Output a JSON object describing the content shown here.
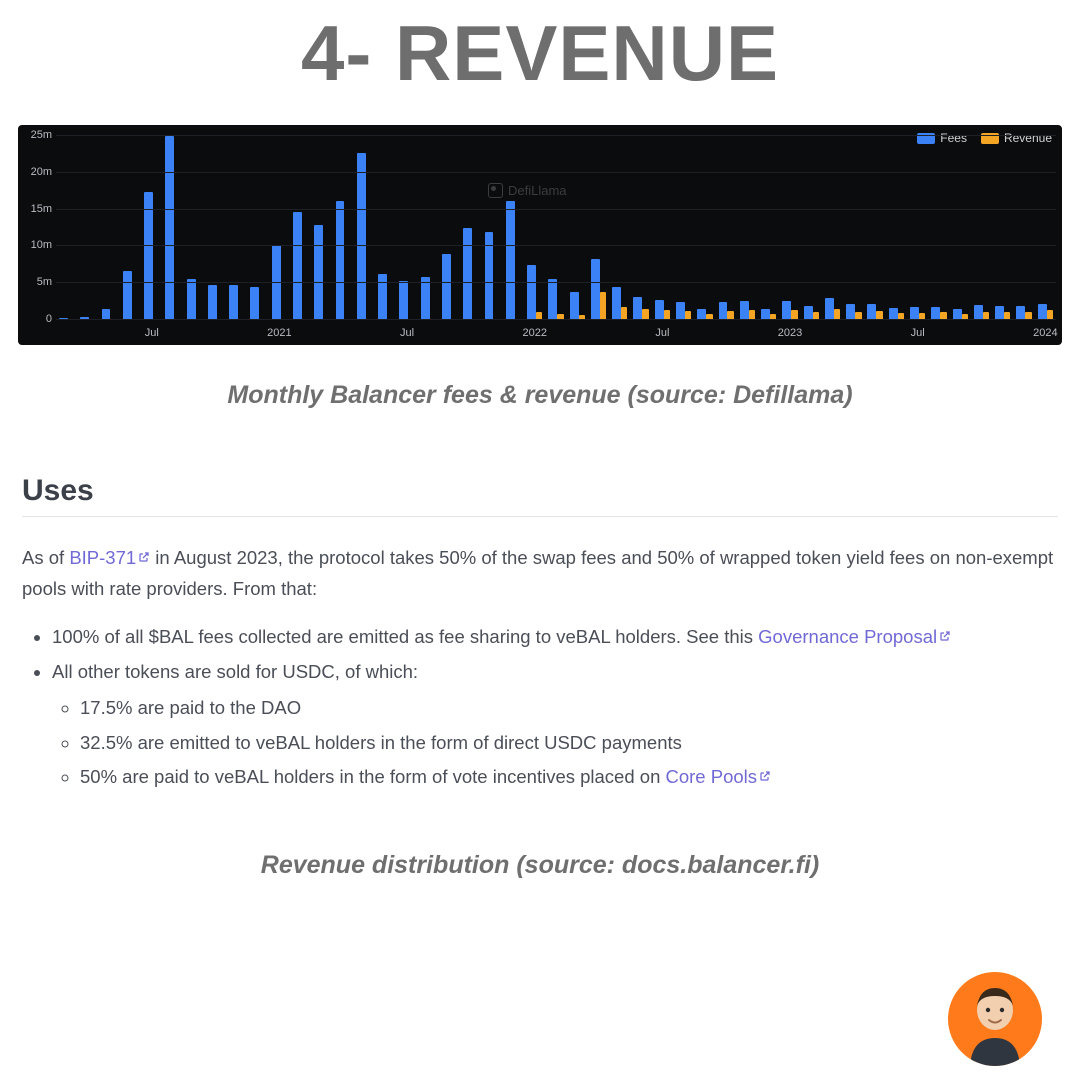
{
  "title": "4- REVENUE",
  "chart_caption": "Monthly Balancer fees & revenue (source: Defillama)",
  "uses": {
    "heading": "Uses",
    "intro_prefix": "As of ",
    "intro_link": "BIP-371",
    "intro_rest": " in August 2023, the protocol takes 50% of the swap fees and 50% of wrapped token yield fees on non-exempt pools with rate providers. From that:",
    "bullets": {
      "b1_prefix": "100% of all $BAL fees collected are emitted as fee sharing to veBAL holders. See this ",
      "b1_link": "Governance Proposal",
      "b2": "All other tokens are sold for USDC, of which:",
      "b2_sub1": "17.5% are paid to the DAO",
      "b2_sub2": "32.5% are emitted to veBAL holders in the form of direct USDC payments",
      "b2_sub3_prefix": "50% are paid to veBAL holders in the form of vote incentives placed on ",
      "b2_sub3_link": "Core Pools"
    }
  },
  "caption2": "Revenue distribution (source: docs.balancer.fi)",
  "chart": {
    "watermark": "DefiLlama",
    "legend": {
      "fees": "Fees",
      "revenue": "Revenue"
    },
    "colors": {
      "fees": "#3b82f6",
      "revenue": "#f5a524",
      "grid": "#1d2024"
    },
    "yaxis": {
      "ticks_m": [
        0,
        5,
        10,
        15,
        20,
        25
      ],
      "max": 25
    },
    "xticks": [
      {
        "label": "Jul",
        "index": 4
      },
      {
        "label": "2021",
        "index": 10
      },
      {
        "label": "Jul",
        "index": 16
      },
      {
        "label": "2022",
        "index": 22
      },
      {
        "label": "Jul",
        "index": 28
      },
      {
        "label": "2023",
        "index": 34
      },
      {
        "label": "Jul",
        "index": 40
      },
      {
        "label": "2024",
        "index": 46
      }
    ]
  },
  "chart_data": {
    "type": "bar",
    "title": "Monthly Balancer fees & revenue",
    "xlabel": "",
    "ylabel": "",
    "ylim": [
      0,
      25
    ],
    "unit": "million USD",
    "categories": [
      "2020-03",
      "2020-04",
      "2020-05",
      "2020-06",
      "2020-07",
      "2020-08",
      "2020-09",
      "2020-10",
      "2020-11",
      "2020-12",
      "2021-01",
      "2021-02",
      "2021-03",
      "2021-04",
      "2021-05",
      "2021-06",
      "2021-07",
      "2021-08",
      "2021-09",
      "2021-10",
      "2021-11",
      "2021-12",
      "2022-01",
      "2022-02",
      "2022-03",
      "2022-04",
      "2022-05",
      "2022-06",
      "2022-07",
      "2022-08",
      "2022-09",
      "2022-10",
      "2022-11",
      "2022-12",
      "2023-01",
      "2023-02",
      "2023-03",
      "2023-04",
      "2023-05",
      "2023-06",
      "2023-07",
      "2023-08",
      "2023-09",
      "2023-10",
      "2023-11",
      "2023-12",
      "2024-01"
    ],
    "series": [
      {
        "name": "Fees",
        "values": [
          0.1,
          0.3,
          1.3,
          6.5,
          17.2,
          24.8,
          5.4,
          4.6,
          4.6,
          4.4,
          10.0,
          14.6,
          12.8,
          16.0,
          22.5,
          6.1,
          5.2,
          5.7,
          8.8,
          12.3,
          11.8,
          16.0,
          7.4,
          5.5,
          3.7,
          8.1,
          4.3,
          3.0,
          2.6,
          2.3,
          1.4,
          2.3,
          2.4,
          1.3,
          2.5,
          1.8,
          2.8,
          2.0,
          2.1,
          1.5,
          1.6,
          1.7,
          1.3,
          1.9,
          1.8,
          1.8,
          2.0
        ]
      },
      {
        "name": "Revenue",
        "values": [
          0,
          0,
          0,
          0,
          0,
          0,
          0,
          0,
          0,
          0,
          0,
          0,
          0,
          0,
          0,
          0,
          0,
          0,
          0,
          0,
          0,
          0,
          0.9,
          0.7,
          0.5,
          3.7,
          1.7,
          1.4,
          1.2,
          1.1,
          0.7,
          1.1,
          1.2,
          0.7,
          1.2,
          0.9,
          1.4,
          1.0,
          1.1,
          0.8,
          0.8,
          0.9,
          0.7,
          1.0,
          0.9,
          0.9,
          1.2
        ]
      }
    ]
  }
}
